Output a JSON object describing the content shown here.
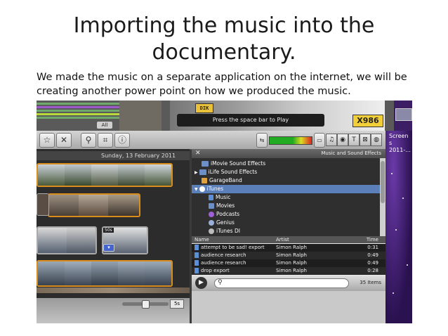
{
  "slide": {
    "title": "Importing the music into the documentary.",
    "body": "We made the music on a separate application on the internet, we will be creating another power point on how we produced the music."
  },
  "imovie": {
    "viewer": {
      "all_button": "All",
      "hint": "Press the space bar to Play",
      "plate_left": "DIK",
      "plate_right": "X986"
    },
    "toolbar": {
      "icons": [
        "star-icon",
        "reject-x-icon",
        "keyword-icon",
        "crop-icon",
        "info-icon"
      ],
      "right_icons": [
        "music-icon",
        "photo-icon",
        "title-icon",
        "transition-icon",
        "map-icon"
      ]
    },
    "event": {
      "date": "Sunday, 13 February 2011",
      "clip_duration_badge": "50s",
      "zoom_value": "5s"
    },
    "browser": {
      "header": "Music and Sound Effects",
      "sources": [
        {
          "label": "iMovie Sound Effects",
          "icon": "folder-icon",
          "indent": 1
        },
        {
          "label": "iLife Sound Effects",
          "icon": "folder-icon",
          "indent": 0
        },
        {
          "label": "GarageBand",
          "icon": "guitar-icon",
          "indent": 0
        },
        {
          "label": "iTunes",
          "icon": "itunes-icon",
          "indent": 0,
          "selected": true
        },
        {
          "label": "Music",
          "icon": "music-note-icon",
          "indent": 1
        },
        {
          "label": "Movies",
          "icon": "film-icon",
          "indent": 1
        },
        {
          "label": "Podcasts",
          "icon": "podcast-icon",
          "indent": 1
        },
        {
          "label": "Genius",
          "icon": "genius-icon",
          "indent": 1
        },
        {
          "label": "iTunes DI",
          "icon": "dj-icon",
          "indent": 1
        }
      ],
      "columns": {
        "name": "Name",
        "artist": "Artist",
        "time": "Time"
      },
      "songs": [
        {
          "name": "attempt to be sad! export",
          "artist": "Simon Ralph",
          "time": "0:31"
        },
        {
          "name": "audience research",
          "artist": "Simon Ralph",
          "time": "0:49"
        },
        {
          "name": "audience research",
          "artist": "Simon Ralph",
          "time": "0:49"
        },
        {
          "name": "drop export",
          "artist": "Simon Ralph",
          "time": "0:28"
        }
      ],
      "item_count": "35 Items"
    },
    "desktop": {
      "label_line1": "Screen s",
      "label_line2": "2011-..."
    }
  }
}
